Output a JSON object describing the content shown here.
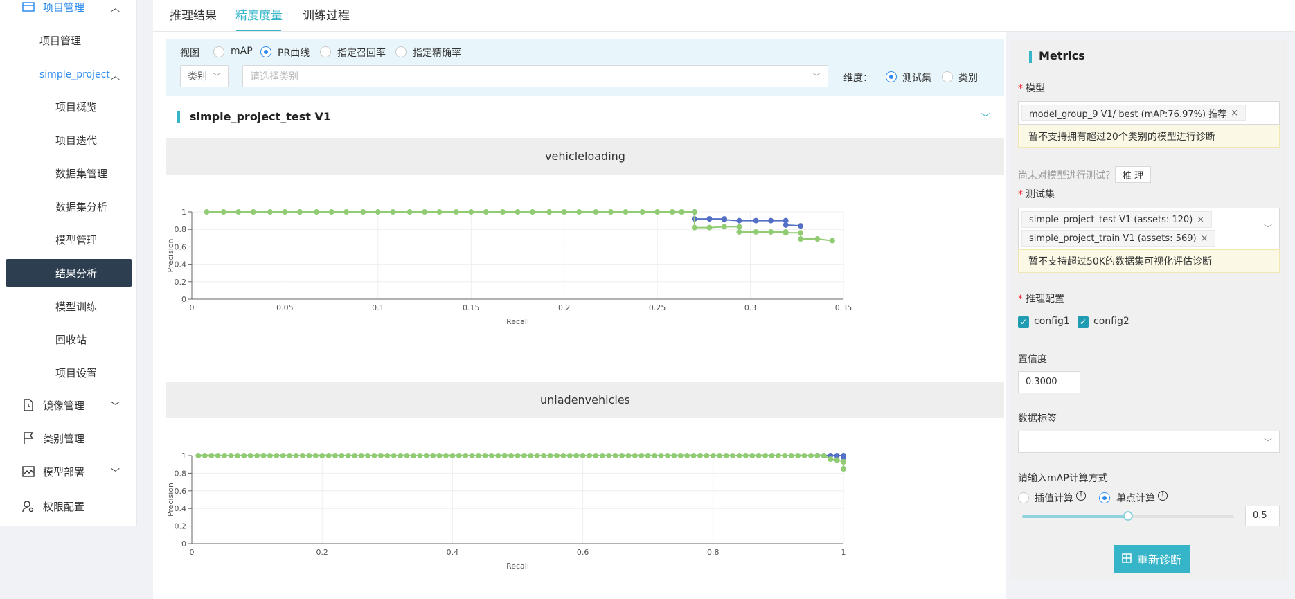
{
  "sidebar": {
    "project_mgmt": "项目管理",
    "project_mgmt_sub": "项目管理",
    "project_name": "simple_project",
    "sub_items": [
      "项目概览",
      "项目迭代",
      "数据集管理",
      "数据集分析",
      "模型管理",
      "结果分析",
      "模型训练",
      "回收站",
      "项目设置"
    ],
    "groups": [
      "镜像管理",
      "类别管理",
      "模型部署",
      "权限配置"
    ],
    "active_color": "#2c3e50"
  },
  "tabs": [
    "推理结果",
    "精度度量",
    "训练过程"
  ],
  "filters": {
    "view_label": "视图",
    "view_options": [
      "mAP",
      "PR曲线",
      "指定召回率",
      "指定精确率"
    ],
    "view_selected": "PR曲线",
    "category_select": "类别",
    "category_placeholder": "请选择类别",
    "dimension_label": "维度：",
    "dimension_options": [
      "测试集",
      "类别"
    ],
    "dimension_selected": "测试集"
  },
  "project_title": "simple_project_test V1",
  "charts": [
    {
      "title": "vehicleloading"
    },
    {
      "title": "unladenvehicles"
    }
  ],
  "chart_data": [
    {
      "type": "line",
      "title": "vehicleloading",
      "xlabel": "Recall",
      "ylabel": "Precision",
      "xlim": [
        0,
        0.35
      ],
      "ylim": [
        0,
        1
      ],
      "xticks": [
        "0",
        "0.05",
        "0.1",
        "0.15",
        "0.2",
        "0.25",
        "0.3",
        "0.35"
      ],
      "yticks": [
        "0",
        "0.2",
        "0.4",
        "0.6",
        "0.8",
        "1"
      ],
      "grid": true,
      "series": [
        {
          "color": "#5470c6",
          "points": [
            [
              0.27,
              1
            ],
            [
              0.27,
              0.92
            ],
            [
              0.278,
              0.92
            ],
            [
              0.286,
              0.92
            ],
            [
              0.286,
              0.91
            ],
            [
              0.294,
              0.9
            ],
            [
              0.303,
              0.9
            ],
            [
              0.311,
              0.9
            ],
            [
              0.319,
              0.9
            ],
            [
              0.319,
              0.85
            ],
            [
              0.327,
              0.84
            ]
          ]
        },
        {
          "color": "#91cc75",
          "points": [
            [
              0.008,
              1
            ],
            [
              0.017,
              1
            ],
            [
              0.025,
              1
            ],
            [
              0.033,
              1
            ],
            [
              0.042,
              1
            ],
            [
              0.05,
              1
            ],
            [
              0.058,
              1
            ],
            [
              0.067,
              1
            ],
            [
              0.075,
              1
            ],
            [
              0.083,
              1
            ],
            [
              0.092,
              1
            ],
            [
              0.1,
              1
            ],
            [
              0.108,
              1
            ],
            [
              0.117,
              1
            ],
            [
              0.125,
              1
            ],
            [
              0.133,
              1
            ],
            [
              0.142,
              1
            ],
            [
              0.15,
              1
            ],
            [
              0.158,
              1
            ],
            [
              0.167,
              1
            ],
            [
              0.175,
              1
            ],
            [
              0.183,
              1
            ],
            [
              0.192,
              1
            ],
            [
              0.2,
              1
            ],
            [
              0.208,
              1
            ],
            [
              0.217,
              1
            ],
            [
              0.225,
              1
            ],
            [
              0.233,
              1
            ],
            [
              0.242,
              1
            ],
            [
              0.25,
              1
            ],
            [
              0.258,
              1
            ],
            [
              0.263,
              1
            ],
            [
              0.27,
              1
            ],
            [
              0.27,
              0.82
            ],
            [
              0.278,
              0.82
            ],
            [
              0.286,
              0.83
            ],
            [
              0.294,
              0.83
            ],
            [
              0.294,
              0.77
            ],
            [
              0.303,
              0.77
            ],
            [
              0.311,
              0.77
            ],
            [
              0.319,
              0.77
            ],
            [
              0.319,
              0.76
            ],
            [
              0.327,
              0.76
            ],
            [
              0.327,
              0.69
            ],
            [
              0.336,
              0.69
            ],
            [
              0.344,
              0.67
            ]
          ]
        }
      ]
    },
    {
      "type": "line",
      "title": "unladenvehicles",
      "xlabel": "Recall",
      "ylabel": "Precision",
      "xlim": [
        0,
        1
      ],
      "ylim": [
        0,
        1
      ],
      "xticks": [
        "0",
        "0.2",
        "0.4",
        "0.6",
        "0.8",
        "1"
      ],
      "yticks": [
        "0",
        "0.2",
        "0.4",
        "0.6",
        "0.8",
        "1"
      ],
      "grid": true,
      "series": [
        {
          "color": "#5470c6",
          "points": [
            [
              0.96,
              1
            ],
            [
              0.97,
              1
            ],
            [
              0.98,
              1
            ],
            [
              0.99,
              1
            ],
            [
              1.0,
              1
            ],
            [
              1.0,
              0.98
            ]
          ]
        },
        {
          "color": "#91cc75",
          "points": [
            [
              0.01,
              1
            ],
            [
              0.02,
              1
            ],
            [
              0.03,
              1
            ],
            [
              0.04,
              1
            ],
            [
              0.05,
              1
            ],
            [
              0.06,
              1
            ],
            [
              0.07,
              1
            ],
            [
              0.08,
              1
            ],
            [
              0.09,
              1
            ],
            [
              0.1,
              1
            ],
            [
              0.11,
              1
            ],
            [
              0.12,
              1
            ],
            [
              0.13,
              1
            ],
            [
              0.14,
              1
            ],
            [
              0.15,
              1
            ],
            [
              0.16,
              1
            ],
            [
              0.17,
              1
            ],
            [
              0.18,
              1
            ],
            [
              0.19,
              1
            ],
            [
              0.2,
              1
            ],
            [
              0.21,
              1
            ],
            [
              0.22,
              1
            ],
            [
              0.23,
              1
            ],
            [
              0.24,
              1
            ],
            [
              0.25,
              1
            ],
            [
              0.26,
              1
            ],
            [
              0.27,
              1
            ],
            [
              0.28,
              1
            ],
            [
              0.29,
              1
            ],
            [
              0.3,
              1
            ],
            [
              0.31,
              1
            ],
            [
              0.32,
              1
            ],
            [
              0.33,
              1
            ],
            [
              0.34,
              1
            ],
            [
              0.35,
              1
            ],
            [
              0.36,
              1
            ],
            [
              0.37,
              1
            ],
            [
              0.38,
              1
            ],
            [
              0.39,
              1
            ],
            [
              0.4,
              1
            ],
            [
              0.41,
              1
            ],
            [
              0.42,
              1
            ],
            [
              0.43,
              1
            ],
            [
              0.44,
              1
            ],
            [
              0.45,
              1
            ],
            [
              0.46,
              1
            ],
            [
              0.47,
              1
            ],
            [
              0.48,
              1
            ],
            [
              0.49,
              1
            ],
            [
              0.5,
              1
            ],
            [
              0.51,
              1
            ],
            [
              0.52,
              1
            ],
            [
              0.53,
              1
            ],
            [
              0.54,
              1
            ],
            [
              0.55,
              1
            ],
            [
              0.56,
              1
            ],
            [
              0.57,
              1
            ],
            [
              0.58,
              1
            ],
            [
              0.59,
              1
            ],
            [
              0.6,
              1
            ],
            [
              0.61,
              1
            ],
            [
              0.62,
              1
            ],
            [
              0.63,
              1
            ],
            [
              0.64,
              1
            ],
            [
              0.65,
              1
            ],
            [
              0.66,
              1
            ],
            [
              0.67,
              1
            ],
            [
              0.68,
              1
            ],
            [
              0.69,
              1
            ],
            [
              0.7,
              1
            ],
            [
              0.71,
              1
            ],
            [
              0.72,
              1
            ],
            [
              0.73,
              1
            ],
            [
              0.74,
              1
            ],
            [
              0.75,
              1
            ],
            [
              0.76,
              1
            ],
            [
              0.77,
              1
            ],
            [
              0.78,
              1
            ],
            [
              0.79,
              1
            ],
            [
              0.8,
              1
            ],
            [
              0.81,
              1
            ],
            [
              0.82,
              1
            ],
            [
              0.83,
              1
            ],
            [
              0.84,
              1
            ],
            [
              0.85,
              1
            ],
            [
              0.86,
              1
            ],
            [
              0.87,
              1
            ],
            [
              0.88,
              1
            ],
            [
              0.89,
              1
            ],
            [
              0.9,
              1
            ],
            [
              0.91,
              1
            ],
            [
              0.92,
              1
            ],
            [
              0.93,
              1
            ],
            [
              0.94,
              1
            ],
            [
              0.95,
              1
            ],
            [
              0.96,
              1
            ],
            [
              0.97,
              1
            ],
            [
              0.98,
              0.96
            ],
            [
              0.99,
              0.95
            ],
            [
              1.0,
              0.93
            ],
            [
              1.0,
              0.85
            ]
          ]
        }
      ]
    }
  ],
  "metrics": {
    "title": "Metrics",
    "model_label": "模型",
    "model_tag": "model_group_9 V1/ best (mAP:76.97%) 推荐",
    "model_warn": "暂不支持拥有超过20个类别的模型进行诊断",
    "untested_hint": "尚未对模型进行测试？",
    "infer_button": "推 理",
    "testset_label": "测试集",
    "testset_tags": [
      "simple_project_test V1  (assets: 120)",
      "simple_project_train V1  (assets: 569)"
    ],
    "testset_warn": "暂不支持超过50K的数据集可视化评估诊断",
    "infer_config_label": "推理配置",
    "configs": [
      "config1",
      "config2"
    ],
    "confidence_label": "置信度",
    "confidence_value": "0.3000",
    "data_tag_label": "数据标签",
    "map_method_label": "请输入mAP计算方式",
    "map_options": [
      "插值计算",
      "单点计算"
    ],
    "map_selected": "单点计算",
    "slider_fraction": 0.5,
    "slider_value": "0.5",
    "rediagnose_button": "重新诊断",
    "accent": "#36b5c9"
  }
}
